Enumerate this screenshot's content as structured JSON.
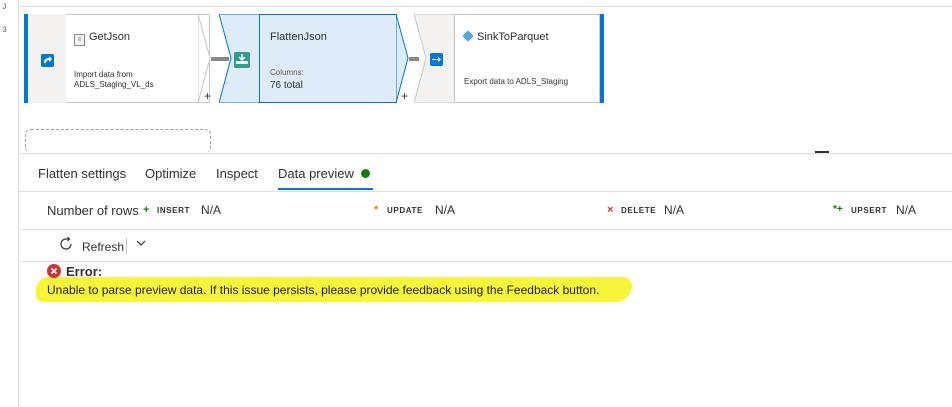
{
  "gutter_marks": [
    "J",
    "3"
  ],
  "nodes": {
    "source": {
      "title": "GetJson",
      "desc_line1": "Import data from",
      "desc_line2": "ADLS_Staging_VL_ds"
    },
    "flatten": {
      "title": "FlattenJson",
      "columns_label": "Columns:",
      "columns_value": "76 total"
    },
    "sink": {
      "title": "SinkToParquet",
      "desc": "Export data to ADLS_Staging"
    },
    "add_symbol": "+"
  },
  "tabs": [
    {
      "label": "Flatten settings"
    },
    {
      "label": "Optimize"
    },
    {
      "label": "Inspect"
    },
    {
      "label": "Data preview",
      "active": true
    }
  ],
  "stats": {
    "label": "Number of rows",
    "insert": {
      "icon": "+",
      "label": "INSERT",
      "value": "N/A"
    },
    "update": {
      "icon": "*",
      "label": "UPDATE",
      "value": "N/A"
    },
    "delete": {
      "icon": "×",
      "label": "DELETE",
      "value": "N/A"
    },
    "upsert": {
      "icon": "*+",
      "label": "UPSERT",
      "value": "N/A"
    }
  },
  "toolbar": {
    "refresh_label": "Refresh"
  },
  "error": {
    "title": "Error:",
    "message": "Unable to parse preview data. If this issue persists, please provide feedback using the Feedback button."
  },
  "colors": {
    "accent": "#0078d4",
    "success": "#107c10",
    "error": "#d13438",
    "highlight": "#f7f53a"
  }
}
